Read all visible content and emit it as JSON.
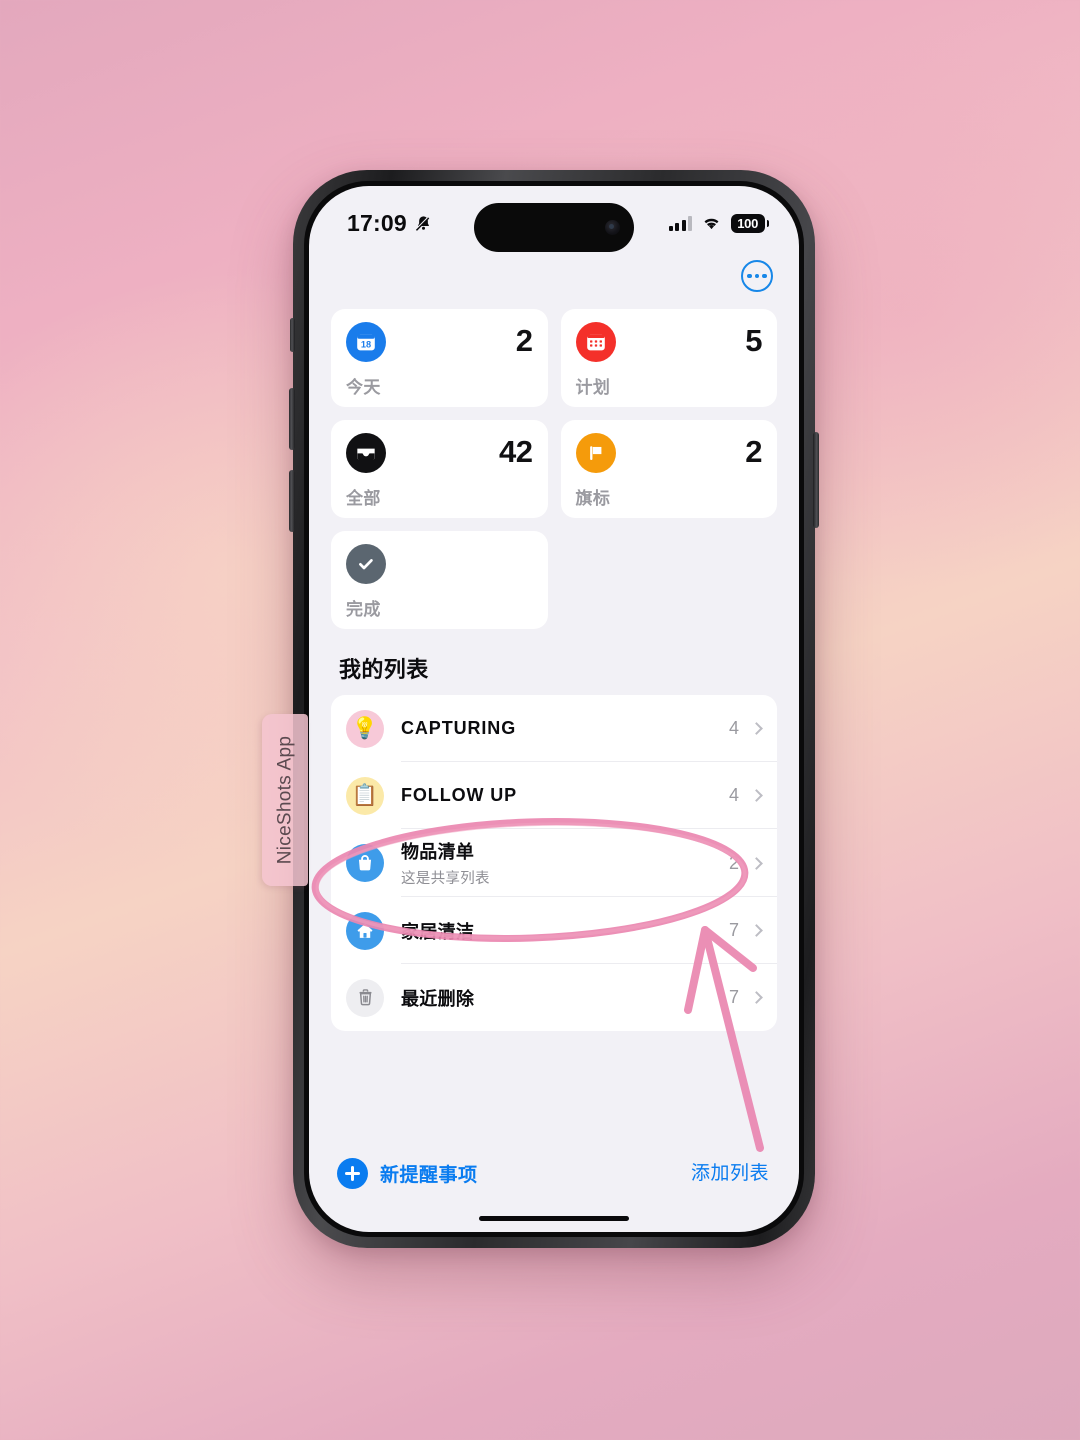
{
  "background": {
    "accent_pink": "#e89ab4",
    "gradient_top": "#e3a8bd",
    "gradient_mid": "#f6d3c4",
    "gradient_bottom": "#dda9bd"
  },
  "watermark": {
    "label": "NiceShots App"
  },
  "status_bar": {
    "time": "17:09",
    "silent_icon": "bell-slash-icon",
    "signal_icon": "cellular-bars-icon",
    "wifi_icon": "wifi-icon",
    "battery_level": "100"
  },
  "nav": {
    "more_icon": "ellipsis-circle-icon",
    "accent": "#1787e8"
  },
  "smart_lists": [
    {
      "label": "今天",
      "count": "2",
      "icon": "calendar-today-icon",
      "icon_bg": "#1a7ceb",
      "icon_glyph": "18"
    },
    {
      "label": "计划",
      "count": "5",
      "icon": "calendar-scheduled-icon",
      "icon_bg": "#f4302a",
      "icon_glyph": ""
    },
    {
      "label": "全部",
      "count": "42",
      "icon": "inbox-all-icon",
      "icon_bg": "#111113",
      "icon_glyph": ""
    },
    {
      "label": "旗标",
      "count": "2",
      "icon": "flag-icon",
      "icon_bg": "#f59b0b",
      "icon_glyph": ""
    },
    {
      "label": "完成",
      "count": "",
      "icon": "checkmark-circle-icon",
      "icon_bg": "#5b6670",
      "icon_glyph": ""
    }
  ],
  "my_lists": {
    "title": "我的列表",
    "rows": [
      {
        "title": "CAPTURING",
        "subtitle": "",
        "count": "4",
        "icon": "lightbulb-icon",
        "icon_bg": "#f7c9d8",
        "icon_glyph": "💡"
      },
      {
        "title": "FOLLOW UP",
        "subtitle": "",
        "count": "4",
        "icon": "clipboard-icon",
        "icon_bg": "#fbe9a8",
        "icon_glyph": "📋"
      },
      {
        "title": "物品清单",
        "subtitle": "这是共享列表",
        "count": "2",
        "icon": "shopping-bag-icon",
        "icon_bg": "#3e9cea",
        "icon_glyph": ""
      },
      {
        "title": "家居清洁",
        "subtitle": "",
        "count": "7",
        "icon": "house-icon",
        "icon_bg": "#3e9cea",
        "icon_glyph": ""
      },
      {
        "title": "最近删除",
        "subtitle": "",
        "count": "7",
        "icon": "trash-icon",
        "icon_bg": "#eeeef1",
        "icon_glyph": ""
      }
    ]
  },
  "bottom_bar": {
    "new_reminder_label": "新提醒事项",
    "new_reminder_icon": "plus-circle-icon",
    "add_list_label": "添加列表",
    "accent": "#0a7cf0"
  },
  "annotations": {
    "highlight_color": "#ea87b0",
    "ellipse_target": "物品清单",
    "arrow_target": "物品清单"
  }
}
